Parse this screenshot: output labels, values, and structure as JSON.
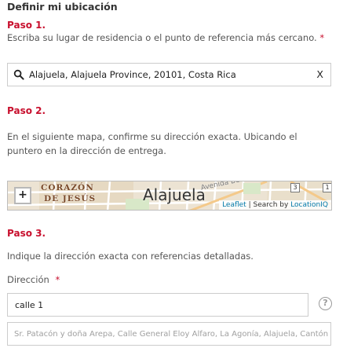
{
  "section_title": "Definir mi ubicación",
  "step1": {
    "label": "Paso 1.",
    "instruction": "Escriba su lugar de residencia o el punto de referencia más cercano.",
    "required_mark": "*",
    "search": {
      "value": "Alajuela, Alajuela Province, 20101, Costa Rica",
      "clear_label": "X",
      "icon": "search-icon"
    }
  },
  "step2": {
    "label": "Paso 2.",
    "instruction_line1": "En el siguiente mapa, confirme su dirección exacta. Ubicando el",
    "instruction_line2": "puntero en la dirección de entrega.",
    "map": {
      "zoom_label": "+",
      "neighborhood_line1": "CORAZÓN",
      "neighborhood_line2": "DE JESÚS",
      "city_label": "Alajuela",
      "street_label": "Avenida Bern",
      "shield1": "3",
      "shield2": "1",
      "attribution_leaflet": "Leaflet",
      "attribution_separator": "| Search by",
      "attribution_provider": "LocationIQ"
    }
  },
  "step3": {
    "label": "Paso 3.",
    "instruction": "Indique la dirección exacta con referencias detalladas.",
    "address_label": "Dirección",
    "required_mark": "*",
    "address_value": "calle 1",
    "help_label": "?",
    "details_placeholder": "Sr. Patacón y doña Arepa, Calle General Eloy Alfaro, La Agonía, Alajuela, Cantón"
  }
}
